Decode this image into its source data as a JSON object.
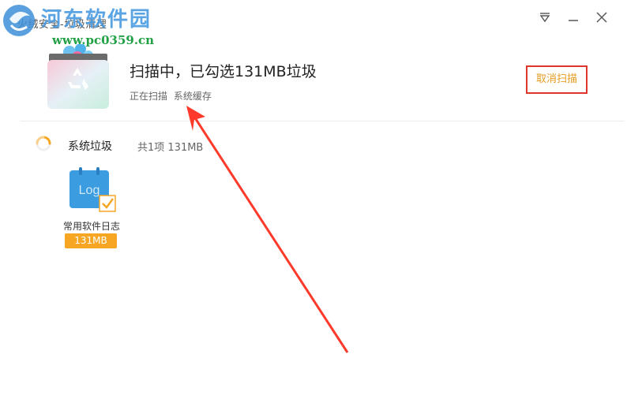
{
  "window": {
    "title": "火绒安全-垃圾清理",
    "watermark_name": "河东软件园",
    "watermark_url": "www.pc0359.cn"
  },
  "scan": {
    "title": "扫描中，已勾选131MB垃圾",
    "status_label": "正在扫描",
    "status_target": "系统缓存",
    "cancel_label": "取消扫描"
  },
  "category": {
    "name": "系统垃圾",
    "summary": "共1项 131MB"
  },
  "items": [
    {
      "label": "常用软件日志",
      "size": "131MB",
      "icon": "log-file-icon",
      "checked": true,
      "icon_text": "Log"
    }
  ],
  "colors": {
    "accent_orange": "#f6a623",
    "cancel_text": "#e49b1e",
    "highlight_red": "#e0352b",
    "log_icon_blue": "#3c9ce0"
  }
}
